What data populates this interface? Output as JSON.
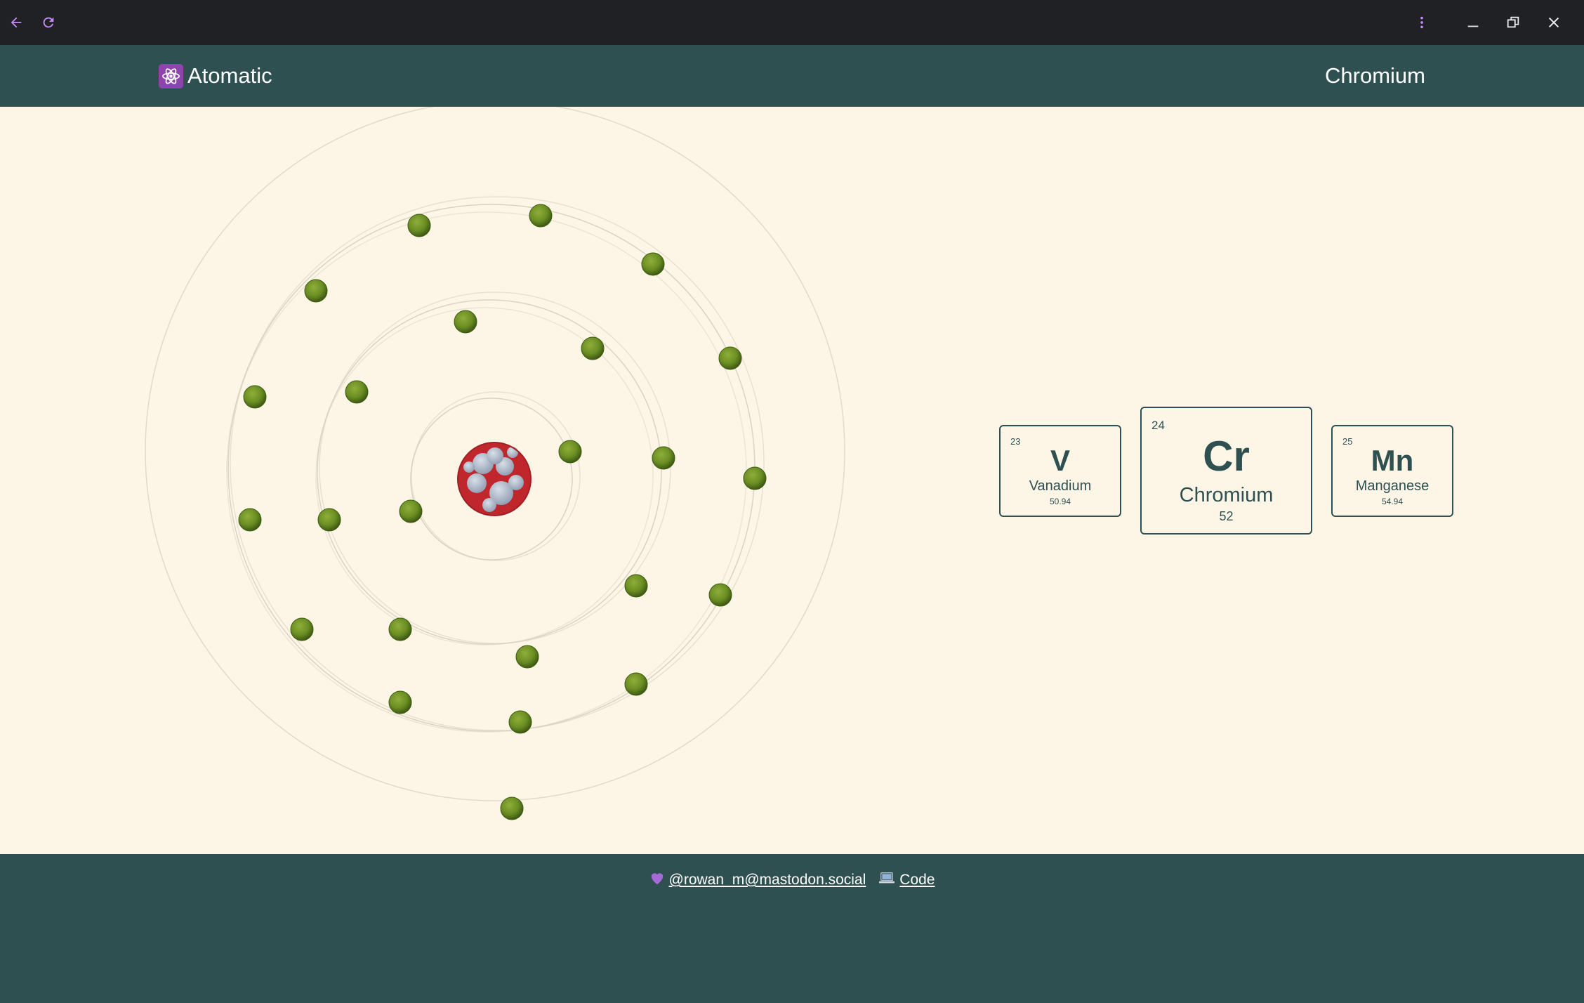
{
  "window": {
    "back_icon": "arrow-left-icon",
    "reload_icon": "refresh-icon",
    "menu_icon": "more-vertical-icon",
    "minimize_icon": "minimize-icon",
    "restore_icon": "restore-window-icon",
    "close_icon": "close-icon",
    "accent_color": "#c58af9"
  },
  "header": {
    "brand_icon": "atom-emoji-icon",
    "brand": "Atomatic",
    "element_name": "Chromium",
    "background": "#2f5051"
  },
  "atom": {
    "nucleus_colors": [
      "#c0272d",
      "#b8c3d6"
    ],
    "electron_color": "#6b8e23",
    "shells": [
      2,
      8,
      13,
      1
    ]
  },
  "elements": {
    "previous": {
      "number": "23",
      "symbol": "V",
      "name": "Vanadium",
      "mass": "50.94"
    },
    "current": {
      "number": "24",
      "symbol": "Cr",
      "name": "Chromium",
      "mass": "52"
    },
    "next": {
      "number": "25",
      "symbol": "Mn",
      "name": "Manganese",
      "mass": "54.94"
    }
  },
  "footer": {
    "heart_icon": "purple-heart-emoji",
    "mastodon_link": "@rowan_m@mastodon.social",
    "laptop_icon": "laptop-emoji",
    "code_link": "Code"
  }
}
